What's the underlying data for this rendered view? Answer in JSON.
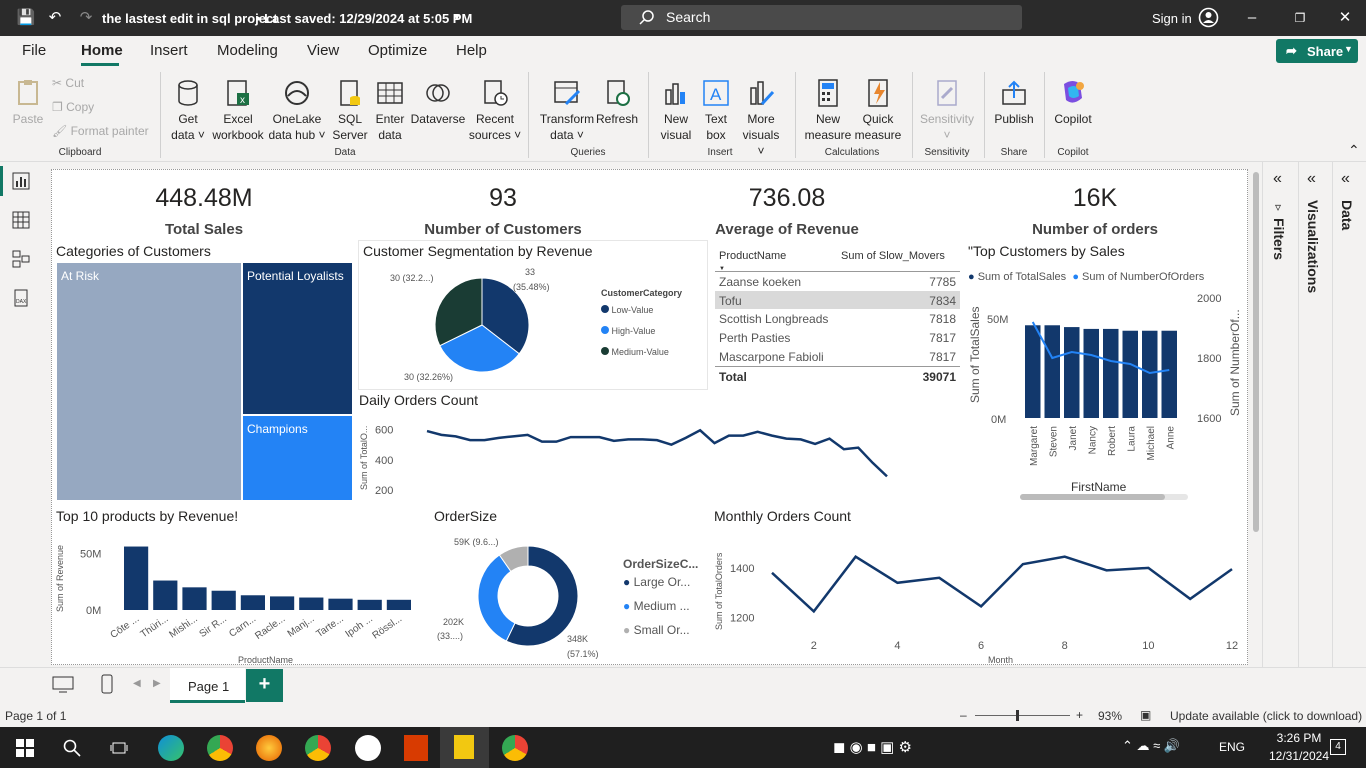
{
  "titlebar": {
    "doc_title": "the lastest edit in sql project",
    "saved": "• Last saved: 12/29/2024 at 5:05 PM",
    "search_placeholder": "Search",
    "signin": "Sign in"
  },
  "menu": {
    "file": "File",
    "home": "Home",
    "insert": "Insert",
    "modeling": "Modeling",
    "view": "View",
    "optimize": "Optimize",
    "help": "Help",
    "share": "Share"
  },
  "ribbon": {
    "paste": "Paste",
    "cut": "Cut",
    "copy": "Copy",
    "format_painter": "Format painter",
    "clipboard": "Clipboard",
    "get_data": [
      "Get",
      "data ˅"
    ],
    "excel": [
      "Excel",
      "workbook"
    ],
    "onelake": [
      "OneLake",
      "data hub ˅"
    ],
    "sql": [
      "SQL",
      "Server"
    ],
    "enter": [
      "Enter",
      "data"
    ],
    "dataverse": "Dataverse",
    "recent": [
      "Recent",
      "sources ˅"
    ],
    "data": "Data",
    "transform": [
      "Transform",
      "data ˅"
    ],
    "refresh": "Refresh",
    "queries": "Queries",
    "new_visual": [
      "New",
      "visual"
    ],
    "text_box": [
      "Text",
      "box"
    ],
    "more_visuals": [
      "More",
      "visuals ˅"
    ],
    "insert": "Insert",
    "new_measure": [
      "New",
      "measure"
    ],
    "quick_measure": [
      "Quick",
      "measure"
    ],
    "calculations": "Calculations",
    "sensitivity": [
      "Sensitivity",
      "˅"
    ],
    "sensitivity_group": "Sensitivity",
    "publish": "Publish",
    "share_group": "Share",
    "copilot": "Copilot",
    "copilot_group": "Copilot"
  },
  "cards": [
    {
      "value": "448.48M",
      "label": "Total Sales"
    },
    {
      "value": "93",
      "label": "Number of Customers"
    },
    {
      "value": "736.08",
      "label": "Average of Revenue"
    },
    {
      "value": "16K",
      "label": "Number of orders"
    }
  ],
  "treemap": {
    "title": "Categories of Customers",
    "cells": [
      {
        "label": "At Risk",
        "color": "#96a8c1"
      },
      {
        "label": "Potential Loyalists",
        "color": "#12386c"
      },
      {
        "label": "Champions",
        "color": "#2383f5"
      }
    ]
  },
  "segmentation": {
    "title": "Customer Segmentation by Revenue",
    "legend_title": "CustomerCategory",
    "labels": [
      "33",
      "(35.48%)",
      "30 (32.26%)",
      "30 (32.2...)"
    ],
    "legend": [
      {
        "name": "Low-Value",
        "color": "#12386c"
      },
      {
        "name": "High-Value",
        "color": "#2383f5"
      },
      {
        "name": "Medium-Value",
        "color": "#1a3c34"
      }
    ]
  },
  "slow_table": {
    "headers": [
      "ProductName",
      "Sum of Slow_Movers"
    ],
    "rows": [
      [
        "Zaanse koeken",
        "7785"
      ],
      [
        "Tofu",
        "7834"
      ],
      [
        "Scottish Longbreads",
        "7818"
      ],
      [
        "Perth Pasties",
        "7817"
      ],
      [
        "Mascarpone Fabioli",
        "7817"
      ]
    ],
    "total": [
      "Total",
      "39071"
    ]
  },
  "top_customers": {
    "title": "\"Top Customers by Sales",
    "legend": [
      "Sum of TotalSales",
      "Sum of NumberOfOrders"
    ],
    "ylabel_left": "Sum of TotalSales",
    "ylabel_right": "Sum of NumberOf...",
    "xlabel": "FirstName",
    "left_ticks": [
      "50M",
      "0M"
    ],
    "right_ticks": [
      "2000",
      "1800",
      "1600"
    ]
  },
  "daily": {
    "title": "Daily Orders Count",
    "ylabel": "Sum of TotalO...",
    "ticks": [
      "600",
      "400",
      "200"
    ]
  },
  "top10": {
    "title": "Top 10 products by Revenue!",
    "ylabel": "Sum of Revenue",
    "xlabel": "ProductName",
    "ticks": [
      "50M",
      "0M"
    ]
  },
  "ordersize": {
    "title": "OrderSize",
    "legend_title": "OrderSizeC...",
    "labels": [
      "59K (9.6...)",
      "202K",
      "(33....)",
      "348K",
      "(57.1%)"
    ],
    "legend": [
      {
        "name": "Large Or...",
        "color": "#12386c"
      },
      {
        "name": "Medium ...",
        "color": "#2383f5"
      },
      {
        "name": "Small Or...",
        "color": "#b0b0b0"
      }
    ]
  },
  "monthly": {
    "title": "Monthly Orders Count",
    "ylabel": "Sum of TotalOrders",
    "xlabel": "Month",
    "yticks": [
      "1400",
      "1200"
    ],
    "xticks": [
      "2",
      "4",
      "6",
      "8",
      "10",
      "12"
    ]
  },
  "panes": {
    "filters": "Filters",
    "visualizations": "Visualizations",
    "data": "Data"
  },
  "pages": {
    "page1": "Page 1",
    "add": "+"
  },
  "status": {
    "page": "Page 1 of 1",
    "zoom": "93%",
    "update": "Update available (click to download)"
  },
  "taskbar": {
    "lang": "ENG",
    "time": "3:26 PM",
    "date": "12/31/2024",
    "badge": "4"
  },
  "chart_data": [
    {
      "type": "bar",
      "title": "\"Top Customers by Sales",
      "xlabel": "FirstName",
      "ylabel": "Sum of TotalSales",
      "categories": [
        "Margaret",
        "Steven",
        "Janet",
        "Nancy",
        "Robert",
        "Laura",
        "Michael",
        "Anne"
      ],
      "series": [
        {
          "name": "Sum of TotalSales",
          "type": "bar",
          "values": [
            51,
            51,
            50,
            49,
            49,
            48,
            48,
            48
          ]
        },
        {
          "name": "Sum of NumberOfOrders",
          "type": "line",
          "values": [
            1920,
            1800,
            1820,
            1810,
            1790,
            1780,
            1750,
            1760
          ]
        }
      ],
      "ylim": [
        0,
        55
      ],
      "y2lim": [
        1600,
        2000
      ]
    },
    {
      "type": "line",
      "title": "Daily Orders Count",
      "ylabel": "Sum of TotalO...",
      "values": [
        590,
        565,
        555,
        530,
        530,
        545,
        555,
        565,
        520,
        520,
        550,
        550,
        550,
        525,
        535,
        535,
        530,
        500,
        545,
        595,
        510,
        560,
        560,
        585,
        560,
        540,
        535,
        505,
        540,
        470,
        480,
        380,
        290
      ],
      "ylim": [
        200,
        650
      ]
    },
    {
      "type": "bar",
      "title": "Top 10 products by Revenue!",
      "xlabel": "ProductName",
      "ylabel": "Sum of Revenue",
      "categories": [
        "Côte ...",
        "Thüri...",
        "Mishi...",
        "Sir R...",
        "Carn...",
        "Racle...",
        "Manj...",
        "Tarte...",
        "Ipoh ...",
        "Rössl..."
      ],
      "values": [
        56,
        26,
        20,
        17,
        13,
        12,
        11,
        10,
        9,
        9
      ],
      "ylim": [
        0,
        60
      ]
    },
    {
      "type": "pie",
      "title": "Customer Segmentation by Revenue",
      "categories": [
        "Low-Value",
        "High-Value",
        "Medium-Value"
      ],
      "values": [
        33,
        30,
        30
      ]
    },
    {
      "type": "pie",
      "title": "OrderSize",
      "donut": true,
      "categories": [
        "Large Or...",
        "Medium ...",
        "Small Or..."
      ],
      "values": [
        348,
        202,
        59
      ]
    },
    {
      "type": "line",
      "title": "Monthly Orders Count",
      "xlabel": "Month",
      "ylabel": "Sum of TotalOrders",
      "x": [
        1,
        2,
        3,
        4,
        5,
        6,
        7,
        8,
        9,
        10,
        11,
        12
      ],
      "values": [
        1380,
        1225,
        1445,
        1340,
        1360,
        1245,
        1415,
        1445,
        1390,
        1400,
        1275,
        1395
      ],
      "xlim": [
        1,
        12
      ],
      "ylim": [
        1150,
        1480
      ]
    }
  ]
}
